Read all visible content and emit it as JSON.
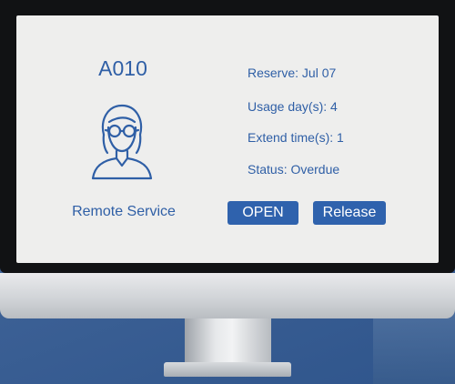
{
  "room": {
    "id": "A010"
  },
  "service": {
    "label": "Remote Service"
  },
  "details": {
    "reserve": "Reserve: Jul 07",
    "usage": "Usage day(s): 4",
    "extend": "Extend time(s): 1",
    "status": "Status: Overdue"
  },
  "actions": {
    "open_label": "OPEN",
    "release_label": "Release"
  },
  "icons": {
    "avatar": "woman-with-glasses-icon"
  },
  "colors": {
    "accent": "#2f62ad",
    "text": "#2f5fa6",
    "screen": "#eeeeed"
  }
}
